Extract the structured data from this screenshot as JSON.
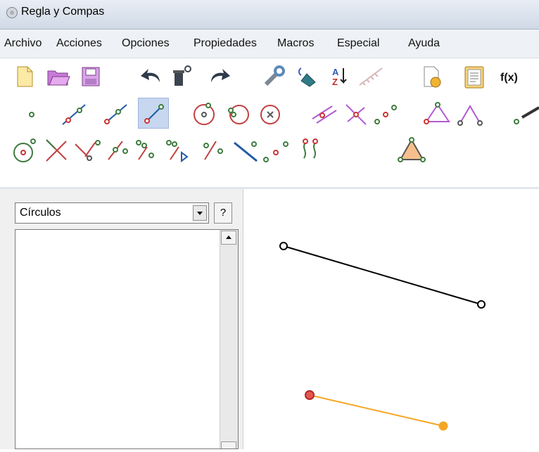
{
  "window": {
    "title": "Regla y Compas"
  },
  "menu": [
    "Archivo",
    "Acciones",
    "Opciones",
    "Propiedades",
    "Macros",
    "Especial",
    "Ayuda"
  ],
  "toolbar": {
    "function_label": "f(x)"
  },
  "left_panel": {
    "category_value": "Círculos",
    "help_label": "?"
  },
  "colors": {
    "segment_black": "#000000",
    "segment_orange": "#f5a623",
    "point_red": "#d9302f",
    "point_orange": "#f5a623"
  }
}
